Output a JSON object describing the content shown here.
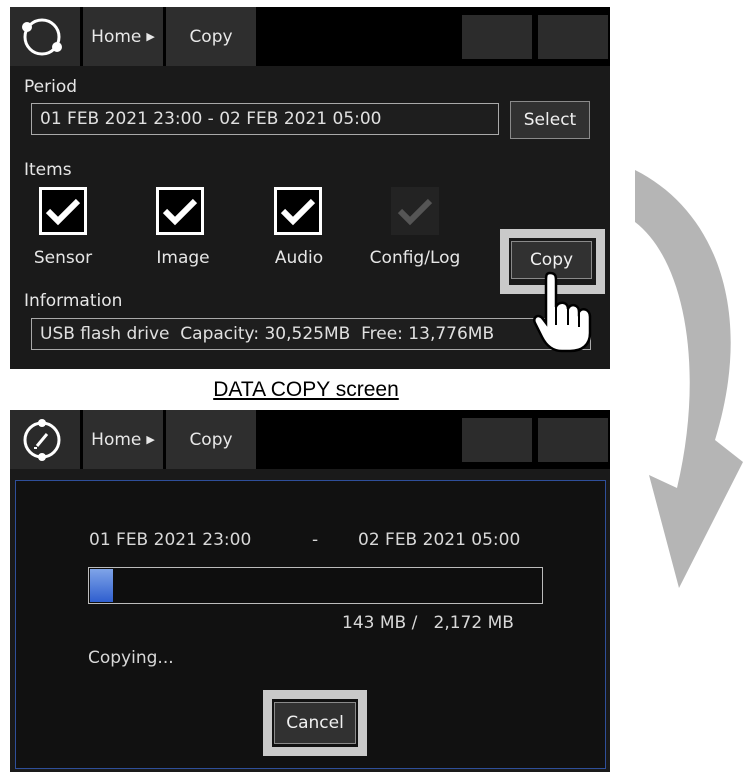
{
  "top_screen": {
    "breadcrumb": {
      "home": "Home",
      "current": "Copy"
    },
    "period": {
      "label": "Period",
      "value": "01 FEB 2021 23:00 - 02 FEB 2021 05:00",
      "select_button": "Select"
    },
    "items": {
      "label": "Items",
      "checkboxes": [
        {
          "label": "Sensor",
          "checked": true
        },
        {
          "label": "Image",
          "checked": true
        },
        {
          "label": "Audio",
          "checked": true
        },
        {
          "label": "Config/Log",
          "checked": true,
          "disabled": true
        }
      ]
    },
    "copy_button": "Copy",
    "information": {
      "label": "Information",
      "value": "USB flash drive  Capacity: 30,525MB  Free: 13,776MB"
    }
  },
  "caption": "DATA COPY screen",
  "bottom_screen": {
    "breadcrumb": {
      "home": "Home",
      "current": "Copy"
    },
    "dialog": {
      "start": "01 FEB 2021 23:00",
      "separator": "-",
      "end": "02 FEB 2021 05:00",
      "progress_fraction": 0.05,
      "progress_text": "143 MB /   2,172 MB",
      "status": "Copying...",
      "cancel_button": "Cancel"
    }
  },
  "colors": {
    "screen_bg": "#1a1a1a",
    "highlight_frame": "#c9c9c9",
    "progress_fill": "#3f6fd6",
    "dialog_border": "#2f4f9a"
  }
}
